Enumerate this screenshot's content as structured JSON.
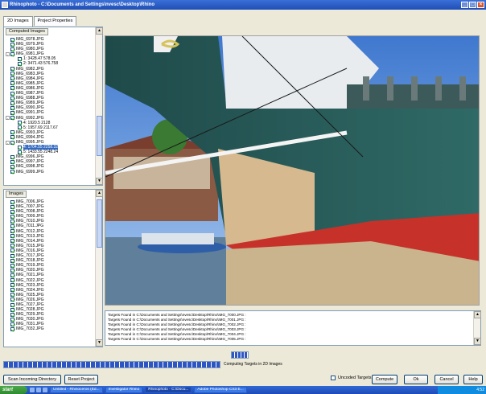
{
  "window": {
    "title": "Rhinophoto - C:\\Documents and Settings\\nvesc\\Desktop\\Rhino"
  },
  "tabs": [
    {
      "label": "2D Images"
    },
    {
      "label": "Project Properties"
    }
  ],
  "computed_panel": {
    "header": "Computed Images",
    "items": [
      {
        "label": "IMG_6978.JPG",
        "level": 0,
        "exp": "",
        "sel": false
      },
      {
        "label": "IMG_6979.JPG",
        "level": 0,
        "exp": "",
        "sel": false
      },
      {
        "label": "IMG_6980.JPG",
        "level": 0,
        "exp": "",
        "sel": false
      },
      {
        "label": "IMG_6981.JPG",
        "level": 0,
        "exp": "-",
        "sel": false
      },
      {
        "label": "1: 3428.47 578.05",
        "level": 1,
        "exp": "",
        "sel": false
      },
      {
        "label": "2: 3471.43 576.758",
        "level": 1,
        "exp": "",
        "sel": false
      },
      {
        "label": "IMG_6982.JPG",
        "level": 0,
        "exp": "",
        "sel": false
      },
      {
        "label": "IMG_6983.JPG",
        "level": 0,
        "exp": "",
        "sel": false
      },
      {
        "label": "IMG_6984.JPG",
        "level": 0,
        "exp": "",
        "sel": false
      },
      {
        "label": "IMG_6985.JPG",
        "level": 0,
        "exp": "",
        "sel": false
      },
      {
        "label": "IMG_6986.JPG",
        "level": 0,
        "exp": "",
        "sel": false
      },
      {
        "label": "IMG_6987.JPG",
        "level": 0,
        "exp": "",
        "sel": false
      },
      {
        "label": "IMG_6988.JPG",
        "level": 0,
        "exp": "",
        "sel": false
      },
      {
        "label": "IMG_6989.JPG",
        "level": 0,
        "exp": "",
        "sel": false
      },
      {
        "label": "IMG_6990.JPG",
        "level": 0,
        "exp": "",
        "sel": false
      },
      {
        "label": "IMG_6991.JPG",
        "level": 0,
        "exp": "",
        "sel": false
      },
      {
        "label": "IMG_6992.JPG",
        "level": 0,
        "exp": "-",
        "sel": false
      },
      {
        "label": "4: 1920.5 2128",
        "level": 1,
        "exp": "",
        "sel": false
      },
      {
        "label": "5: 1957.69 2117.67",
        "level": 1,
        "exp": "",
        "sel": false
      },
      {
        "label": "IMG_6993.JPG",
        "level": 0,
        "exp": "",
        "sel": false
      },
      {
        "label": "IMG_6994.JPG",
        "level": 0,
        "exp": "",
        "sel": false
      },
      {
        "label": "IMG_6995.JPG",
        "level": 0,
        "exp": "-",
        "sel": false
      },
      {
        "label": "4: 1704.55 2258.32",
        "level": 1,
        "exp": "",
        "sel": true
      },
      {
        "label": "5: 1433.55 2248.24",
        "level": 1,
        "exp": "",
        "sel": false
      },
      {
        "label": "IMG_6996.JPG",
        "level": 0,
        "exp": "",
        "sel": false
      },
      {
        "label": "IMG_6997.JPG",
        "level": 0,
        "exp": "",
        "sel": false
      },
      {
        "label": "IMG_6998.JPG",
        "level": 0,
        "exp": "",
        "sel": false
      },
      {
        "label": "IMG_6999.JPG",
        "level": 0,
        "exp": "",
        "sel": false
      }
    ]
  },
  "images_panel": {
    "header": "Images",
    "items": [
      "IMG_7006.JPG",
      "IMG_7007.JPG",
      "IMG_7008.JPG",
      "IMG_7009.JPG",
      "IMG_7010.JPG",
      "IMG_7011.JPG",
      "IMG_7012.JPG",
      "IMG_7013.JPG",
      "IMG_7014.JPG",
      "IMG_7015.JPG",
      "IMG_7016.JPG",
      "IMG_7017.JPG",
      "IMG_7018.JPG",
      "IMG_7019.JPG",
      "IMG_7020.JPG",
      "IMG_7021.JPG",
      "IMG_7022.JPG",
      "IMG_7023.JPG",
      "IMG_7024.JPG",
      "IMG_7025.JPG",
      "IMG_7026.JPG",
      "IMG_7027.JPG",
      "IMG_7028.JPG",
      "IMG_7029.JPG",
      "IMG_7030.JPG",
      "IMG_7031.JPG",
      "IMG_7032.JPG"
    ]
  },
  "log": {
    "lines": [
      "Targets Found in C:\\Documents and Settings\\nvesc\\Desktop\\Rhino\\IMG_7000.JPG :",
      "Targets Found in C:\\Documents and Settings\\nvesc\\Desktop\\Rhino\\IMG_7001.JPG :",
      "Targets Found in C:\\Documents and Settings\\nvesc\\Desktop\\Rhino\\IMG_7002.JPG :",
      "Targets Found in C:\\Documents and Settings\\nvesc\\Desktop\\Rhino\\IMG_7003.JPG :",
      "Targets Found in C:\\Documents and Settings\\nvesc\\Desktop\\Rhino\\IMG_7004.JPG :",
      "Targets Found in C:\\Documents and Settings\\nvesc\\Desktop\\Rhino\\IMG_7005.JPG :"
    ]
  },
  "progress": {
    "status": "Computing Targets in 2D Images",
    "fraction": 0.45
  },
  "buttons": {
    "scan": "Scan Incoming Directory",
    "reset": "Reset Project",
    "uncoded": "Uncoded Targets",
    "compute": "Compute",
    "ok": "Ok",
    "cancel": "Cancel",
    "help": "Help"
  },
  "taskbar": {
    "start": "start",
    "items": [
      "Untitled - Rhinoceros (Ed...",
      "Investigator Rhino",
      "Rhinophoto - C:\\Docu...",
      "Adobe Photoshop CS3 E..."
    ],
    "clock": "4:52"
  },
  "colors": {
    "accent": "#316ac5",
    "title": "#1f4fb4"
  }
}
